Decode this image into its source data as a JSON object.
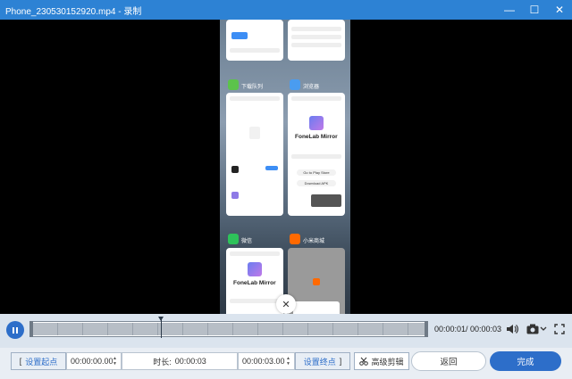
{
  "window": {
    "title": "Phone_230530152920.mp4  -  录制",
    "minimize": "—",
    "maximize": "☐",
    "close": "✕"
  },
  "phone_screen": {
    "apps": [
      {
        "label": "下载队列",
        "color": "#5cc34b"
      },
      {
        "label": "浏览器",
        "color": "#4a9cf0"
      },
      {
        "label": "微信",
        "color": "#2ec25a"
      },
      {
        "label": "小米商城",
        "color": "#ff6900"
      }
    ],
    "card_fonelab_1": {
      "title": "FoneLab Mirror",
      "btn1": "Go to Play Store",
      "btn2": "Download APK"
    },
    "card_fonelab_2": {
      "title": "FoneLab Mirror"
    },
    "close_symbol": "✕"
  },
  "player": {
    "timecode": "00:00:01/ 00:00:03",
    "progress": 0.33
  },
  "trim": {
    "set_start_label": "设置起点",
    "start_value": "00:00:00.00",
    "duration_label": "时长:",
    "duration_value": "00:00:03",
    "end_value": "00:00:03.00",
    "set_end_label": "设置终点",
    "advanced_label": "高级剪辑",
    "back_label": "返回",
    "done_label": "完成"
  },
  "colors": {
    "accent": "#2d82d4",
    "primary_button": "#2d6ec9"
  }
}
